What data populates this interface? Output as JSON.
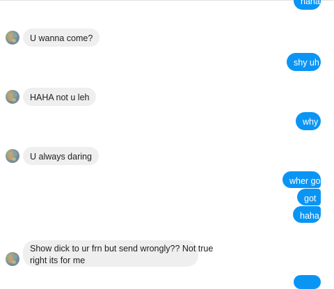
{
  "conversation": {
    "messages": [
      {
        "id": "m0",
        "from": "me",
        "text": "haha"
      },
      {
        "id": "m1",
        "from": "them",
        "text": "U wanna come?"
      },
      {
        "id": "m2",
        "from": "me",
        "text": "shy uh"
      },
      {
        "id": "m3",
        "from": "them",
        "text": "HAHA not u leh"
      },
      {
        "id": "m4",
        "from": "me",
        "text": "why"
      },
      {
        "id": "m5",
        "from": "them",
        "text": "U always daring"
      },
      {
        "id": "m6",
        "from": "me",
        "text": "wher go"
      },
      {
        "id": "m7",
        "from": "me",
        "text": "got"
      },
      {
        "id": "m8",
        "from": "me",
        "text": "haha"
      },
      {
        "id": "m9",
        "from": "them",
        "line1": "Show dick to ur frn but send wrongly?? Not true",
        "line2": "right its for me"
      },
      {
        "id": "m10",
        "from": "me",
        "text": ""
      }
    ]
  },
  "colors": {
    "outgoing_bubble": "#0a95f5",
    "incoming_bubble": "#efefef",
    "outgoing_text": "#ffffff",
    "incoming_text": "#1c1e21"
  }
}
